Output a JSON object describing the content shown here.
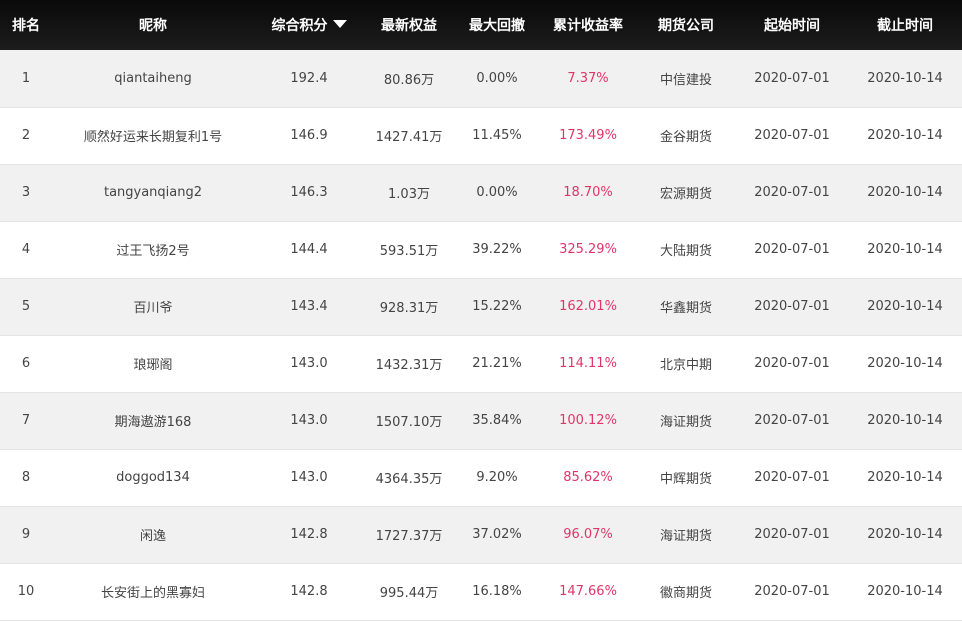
{
  "headers": {
    "rank": "排名",
    "nickname": "昵称",
    "score": "综合积分",
    "equity": "最新权益",
    "drawdown": "最大回撤",
    "return_rate": "累计收益率",
    "company": "期货公司",
    "start": "起始时间",
    "end": "截止时间"
  },
  "sort_icon": "caret-down-icon",
  "colors": {
    "header_bg": "#111111",
    "rate_text": "#e0356b",
    "row_alt": "#f1f1f1"
  },
  "rows": [
    {
      "rank": "1",
      "nickname": "qiantaiheng",
      "score": "192.4",
      "equity": "80.86万",
      "drawdown": "0.00%",
      "return_rate": "7.37%",
      "company": "中信建投",
      "start": "2020-07-01",
      "end": "2020-10-14"
    },
    {
      "rank": "2",
      "nickname": "顺然好运来长期复利1号",
      "score": "146.9",
      "equity": "1427.41万",
      "drawdown": "11.45%",
      "return_rate": "173.49%",
      "company": "金谷期货",
      "start": "2020-07-01",
      "end": "2020-10-14"
    },
    {
      "rank": "3",
      "nickname": "tangyanqiang2",
      "score": "146.3",
      "equity": "1.03万",
      "drawdown": "0.00%",
      "return_rate": "18.70%",
      "company": "宏源期货",
      "start": "2020-07-01",
      "end": "2020-10-14"
    },
    {
      "rank": "4",
      "nickname": "过王飞扬2号",
      "score": "144.4",
      "equity": "593.51万",
      "drawdown": "39.22%",
      "return_rate": "325.29%",
      "company": "大陆期货",
      "start": "2020-07-01",
      "end": "2020-10-14"
    },
    {
      "rank": "5",
      "nickname": "百川爷",
      "score": "143.4",
      "equity": "928.31万",
      "drawdown": "15.22%",
      "return_rate": "162.01%",
      "company": "华鑫期货",
      "start": "2020-07-01",
      "end": "2020-10-14"
    },
    {
      "rank": "6",
      "nickname": "琅琊阁",
      "score": "143.0",
      "equity": "1432.31万",
      "drawdown": "21.21%",
      "return_rate": "114.11%",
      "company": "北京中期",
      "start": "2020-07-01",
      "end": "2020-10-14"
    },
    {
      "rank": "7",
      "nickname": "期海遨游168",
      "score": "143.0",
      "equity": "1507.10万",
      "drawdown": "35.84%",
      "return_rate": "100.12%",
      "company": "海证期货",
      "start": "2020-07-01",
      "end": "2020-10-14"
    },
    {
      "rank": "8",
      "nickname": "doggod134",
      "score": "143.0",
      "equity": "4364.35万",
      "drawdown": "9.20%",
      "return_rate": "85.62%",
      "company": "中辉期货",
      "start": "2020-07-01",
      "end": "2020-10-14"
    },
    {
      "rank": "9",
      "nickname": "闲逸",
      "score": "142.8",
      "equity": "1727.37万",
      "drawdown": "37.02%",
      "return_rate": "96.07%",
      "company": "海证期货",
      "start": "2020-07-01",
      "end": "2020-10-14"
    },
    {
      "rank": "10",
      "nickname": "长安街上的黑寡妇",
      "score": "142.8",
      "equity": "995.44万",
      "drawdown": "16.18%",
      "return_rate": "147.66%",
      "company": "徽商期货",
      "start": "2020-07-01",
      "end": "2020-10-14"
    }
  ]
}
